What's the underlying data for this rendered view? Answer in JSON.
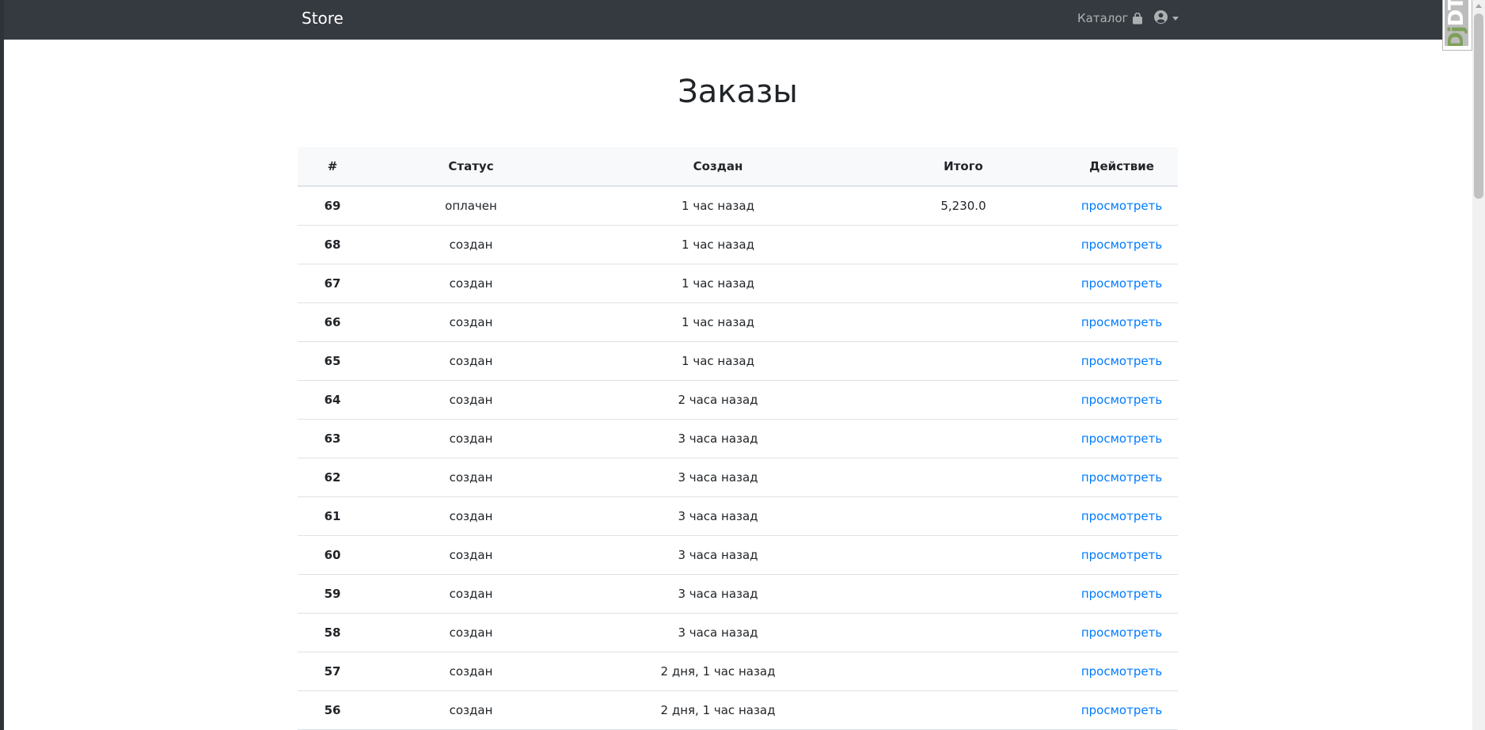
{
  "navbar": {
    "brand": "Store",
    "catalog_label": "Каталог"
  },
  "dev_toolbar": {
    "label_dj": "Dj",
    "label_dt": "DT"
  },
  "page": {
    "title": "Заказы"
  },
  "table": {
    "columns": [
      "#",
      "Статус",
      "Создан",
      "Итого",
      "Действие"
    ],
    "rows": [
      {
        "id": "69",
        "status": "оплачен",
        "created": "1 час назад",
        "total": "5,230.0",
        "action": "просмотреть"
      },
      {
        "id": "68",
        "status": "создан",
        "created": "1 час назад",
        "total": "",
        "action": "просмотреть"
      },
      {
        "id": "67",
        "status": "создан",
        "created": "1 час назад",
        "total": "",
        "action": "просмотреть"
      },
      {
        "id": "66",
        "status": "создан",
        "created": "1 час назад",
        "total": "",
        "action": "просмотреть"
      },
      {
        "id": "65",
        "status": "создан",
        "created": "1 час назад",
        "total": "",
        "action": "просмотреть"
      },
      {
        "id": "64",
        "status": "создан",
        "created": "2 часа назад",
        "total": "",
        "action": "просмотреть"
      },
      {
        "id": "63",
        "status": "создан",
        "created": "3 часа назад",
        "total": "",
        "action": "просмотреть"
      },
      {
        "id": "62",
        "status": "создан",
        "created": "3 часа назад",
        "total": "",
        "action": "просмотреть"
      },
      {
        "id": "61",
        "status": "создан",
        "created": "3 часа назад",
        "total": "",
        "action": "просмотреть"
      },
      {
        "id": "60",
        "status": "создан",
        "created": "3 часа назад",
        "total": "",
        "action": "просмотреть"
      },
      {
        "id": "59",
        "status": "создан",
        "created": "3 часа назад",
        "total": "",
        "action": "просмотреть"
      },
      {
        "id": "58",
        "status": "создан",
        "created": "3 часа назад",
        "total": "",
        "action": "просмотреть"
      },
      {
        "id": "57",
        "status": "создан",
        "created": "2 дня, 1 час назад",
        "total": "",
        "action": "просмотреть"
      },
      {
        "id": "56",
        "status": "создан",
        "created": "2 дня, 1 час назад",
        "total": "",
        "action": "просмотреть"
      }
    ]
  },
  "icons": {
    "catalog": "shopping-bag-icon",
    "user": "user-circle-icon",
    "dropdown": "caret-down-icon"
  },
  "colors": {
    "navbar_bg": "#343a40",
    "link": "#007bff"
  }
}
